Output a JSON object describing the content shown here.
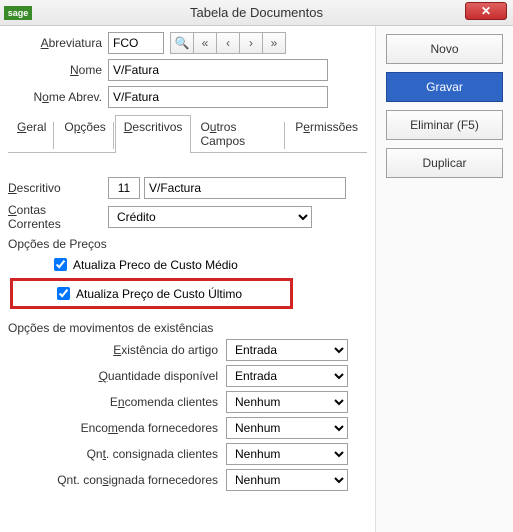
{
  "window": {
    "logo": "sage",
    "title": "Tabela de Documentos"
  },
  "form": {
    "abrev_label": "Abreviatura",
    "abrev_value": "FCO",
    "nome_label": "Nome",
    "nome_value": "V/Fatura",
    "nome_abrev_label": "Nome Abrev.",
    "nome_abrev_value": "V/Fatura"
  },
  "nav": {
    "search": "🔍",
    "first": "«",
    "prev": "‹",
    "next": "›",
    "last": "»"
  },
  "tabs": {
    "geral": "Geral",
    "opcoes": "Opções",
    "descritivos": "Descritivos",
    "outros": "Outros Campos",
    "permissoes": "Permissões"
  },
  "desc": {
    "label": "Descritivo",
    "num": "11",
    "text": "V/Factura",
    "cc_label": "Contas Correntes",
    "cc_value": "Crédito",
    "op_precos": "Opções de  Preços",
    "chk_medio": "Atualiza Preco de Custo Médio",
    "chk_ultimo": "Atualiza Preço de Custo Último",
    "op_mov": "Opções de movimentos de existências"
  },
  "mov": {
    "exist_label": "Existência do artigo",
    "exist_value": "Entrada",
    "qd_label": "Quantidade disponível",
    "qd_value": "Entrada",
    "ec_label": "Encomenda clientes",
    "ec_value": "Nenhum",
    "ef_label": "Encomenda fornecedores",
    "ef_value": "Nenhum",
    "qcc_label": "Qnt. consignada clientes",
    "qcc_value": "Nenhum",
    "qcf_label": "Qnt. consignada fornecedores",
    "qcf_value": "Nenhum"
  },
  "actions": {
    "novo": "Novo",
    "gravar": "Gravar",
    "eliminar": "Eliminar (F5)",
    "duplicar": "Duplicar"
  }
}
